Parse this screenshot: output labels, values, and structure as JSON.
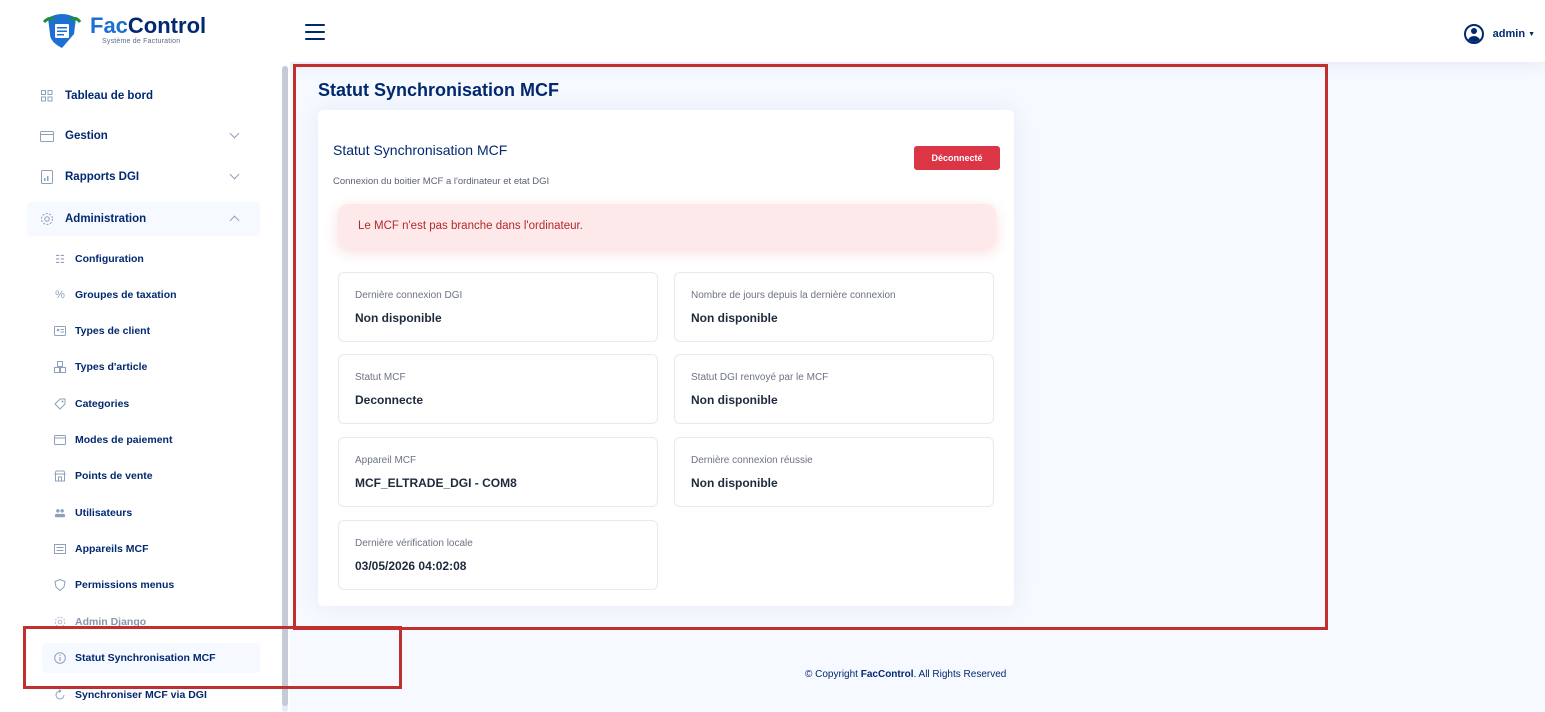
{
  "app": {
    "brand_prefix": "Fac",
    "brand_suffix": "Control",
    "brand_tagline": "Système de Facturation",
    "user_name": "admin"
  },
  "sidebar": {
    "items": [
      {
        "label": "Tableau de bord",
        "icon": "grid-icon"
      },
      {
        "label": "Gestion",
        "icon": "folder-icon"
      },
      {
        "label": "Rapports DGI",
        "icon": "report-icon"
      },
      {
        "label": "Administration",
        "icon": "gear-icon"
      }
    ],
    "admin_sub": [
      {
        "label": "Configuration",
        "icon": "sliders-icon"
      },
      {
        "label": "Groupes de taxation",
        "icon": "percent-icon"
      },
      {
        "label": "Types de client",
        "icon": "id-card-icon"
      },
      {
        "label": "Types d'article",
        "icon": "boxes-icon"
      },
      {
        "label": "Categories",
        "icon": "tag-icon"
      },
      {
        "label": "Modes de paiement",
        "icon": "wallet-icon"
      },
      {
        "label": "Points de vente",
        "icon": "shop-icon"
      },
      {
        "label": "Utilisateurs",
        "icon": "users-icon"
      },
      {
        "label": "Appareils MCF",
        "icon": "device-icon"
      },
      {
        "label": "Permissions menus",
        "icon": "shield-icon"
      },
      {
        "label": "Admin Django",
        "icon": "gear-icon"
      },
      {
        "label": "Statut Synchronisation MCF",
        "icon": "info-icon"
      },
      {
        "label": "Synchroniser MCF via DGI",
        "icon": "sync-icon"
      }
    ]
  },
  "main": {
    "page_title": "Statut Synchronisation MCF",
    "card_title": "Statut Synchronisation MCF",
    "card_subtitle": "Connexion du boitier MCF a l'ordinateur et etat DGI",
    "status_badge": "Déconnecté",
    "status_color": "#dc3545",
    "alert_text": "Le MCF n'est pas branche dans l'ordinateur.",
    "info": [
      {
        "label": "Dernière connexion DGI",
        "value": "Non disponible"
      },
      {
        "label": "Nombre de jours depuis la dernière connexion",
        "value": "Non disponible"
      },
      {
        "label": "Statut MCF",
        "value": "Deconnecte"
      },
      {
        "label": "Statut DGI renvoyé par le MCF",
        "value": "Non disponible"
      },
      {
        "label": "Appareil MCF",
        "value": "MCF_ELTRADE_DGI - COM8"
      },
      {
        "label": "Dernière connexion réussie",
        "value": "Non disponible"
      },
      {
        "label": "Dernière vérification locale",
        "value": "03/05/2026 04:02:08"
      }
    ]
  },
  "footer": {
    "prefix": "© Copyright ",
    "brand": "FacControl",
    "suffix": ". All Rights Reserved"
  }
}
